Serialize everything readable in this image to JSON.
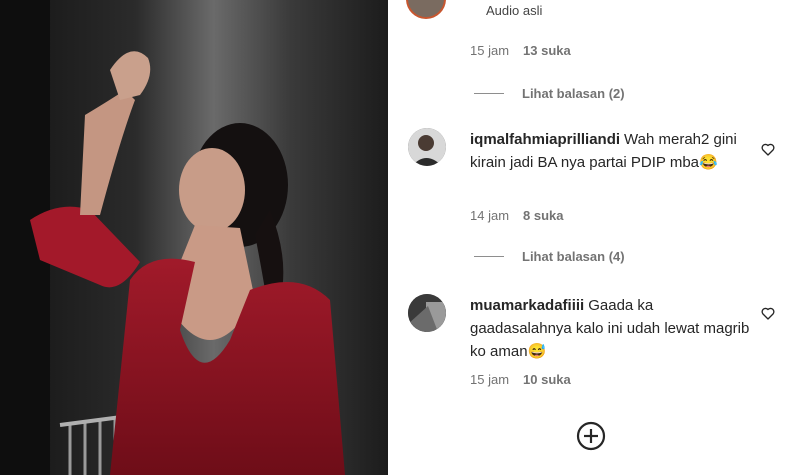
{
  "post": {
    "audio_label": "Audio asli"
  },
  "comments": [
    {
      "meta": {
        "time": "15 jam",
        "likes": "13 suka"
      },
      "view_replies": "Lihat balasan (2)"
    },
    {
      "username": "iqmalfahmiaprilliandi",
      "text": "Wah merah2 gini kirain jadi BA nya partai PDIP mba😂",
      "meta": {
        "time": "14 jam",
        "likes": "8 suka"
      },
      "view_replies": "Lihat balasan (4)"
    },
    {
      "username": "muamarkadafiiii",
      "text": "Gaada ka gaadasalahnya kalo ini udah lewat magrib ko aman😅",
      "meta": {
        "time": "15 jam",
        "likes": "10 suka"
      }
    }
  ],
  "icons": {
    "like": "heart-icon",
    "add": "plus-circle-icon"
  }
}
